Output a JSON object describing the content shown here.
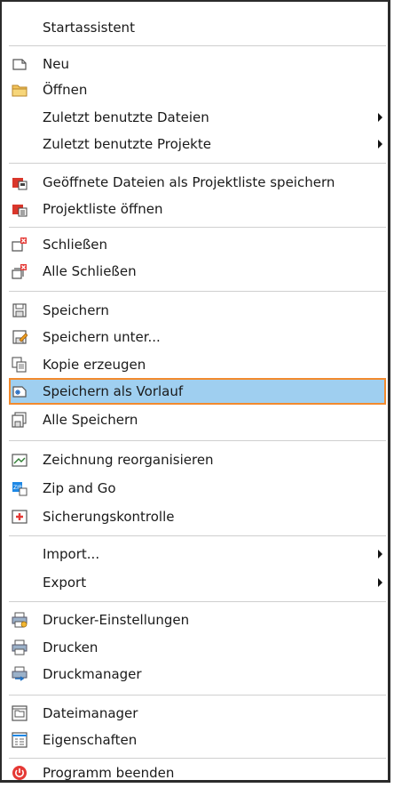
{
  "menu": {
    "startassistent": "Startassistent",
    "neu": "Neu",
    "oeffnen": "Öffnen",
    "zuletzt_dateien": "Zuletzt benutzte Dateien",
    "zuletzt_projekte": "Zuletzt benutzte Projekte",
    "geoeffnete_als_projektliste": "Geöffnete Dateien als Projektliste speichern",
    "projektliste_oeffnen": "Projektliste öffnen",
    "schliessen": "Schließen",
    "alle_schliessen": "Alle Schließen",
    "speichern": "Speichern",
    "speichern_unter": "Speichern unter...",
    "kopie_erzeugen": "Kopie erzeugen",
    "speichern_als_vorlauf": "Speichern als Vorlauf",
    "alle_speichern": "Alle Speichern",
    "zeichnung_reorganisieren": "Zeichnung reorganisieren",
    "zip_and_go": "Zip and Go",
    "sicherungskontrolle": "Sicherungskontrolle",
    "import": "Import...",
    "export": "Export",
    "drucker_einstellungen": "Drucker-Einstellungen",
    "drucken": "Drucken",
    "druckmanager": "Druckmanager",
    "dateimanager": "Dateimanager",
    "eigenschaften": "Eigenschaften",
    "programm_beenden": "Programm beenden"
  },
  "colors": {
    "highlight_fill": "#9fcff0",
    "highlight_border": "#f28a2e",
    "separator": "#cfcfcf"
  }
}
